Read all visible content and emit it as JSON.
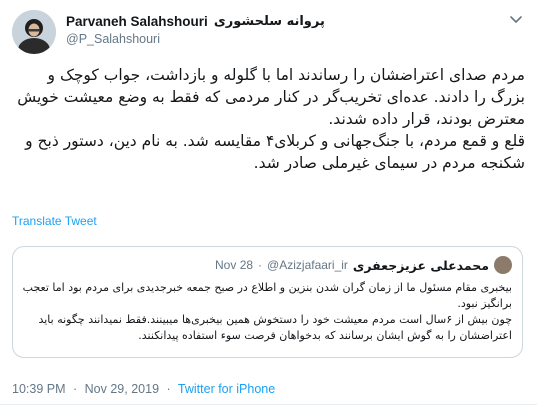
{
  "author": {
    "display_name": "Parvaneh Salahshouri",
    "display_name_fa": "پروانه سلحشوری",
    "handle": "@P_Salahshouri"
  },
  "tweet": {
    "paragraphs": [
      "مردم صدای اعتراضشان را رساندند اما با گلوله و بازداشت، جواب کوچک و بزرگ را دادند. عده‌ای تخریب‌گر در کنار مردمی که فقط به وضع معیشت خویش معترض بودند، قرار داده شدند.",
      "قلع و قمع مردم، با جنگ‌جهانی و کربلای۴ مقایسه شد. به نام دین، دستور ذبح و شکنجه مردم در سیمای غیرملی صادر شد."
    ],
    "translate_label": "Translate Tweet"
  },
  "quoted": {
    "name": "محمدعلی عزیزجعفری",
    "handle": "@Azizjafaari_ir",
    "dot": "·",
    "date": "Nov 28",
    "paragraphs": [
      "بیخبری مقام مسئول ما از زمان گران شدن بنزین و اطلاع در صبح جمعه خبرجدیدی برای مردم بود اما تعجب برانگیز نبود.",
      "چون بیش از ۶سال است مردم معیشت خود را دستخوش همین بیخبری‌ها میبینند.فقط نمیدانند چگونه باید اعتراضشان را به گوش ایشان برسانند که بدخواهان فرصت سوء استفاده پیدانکنند."
    ]
  },
  "meta": {
    "time": "10:39 PM",
    "dot": "·",
    "date": "Nov 29, 2019",
    "source": "Twitter for iPhone"
  },
  "icons": {
    "menu": "chevron-down-icon",
    "avatar": "avatar"
  },
  "colors": {
    "link": "#1da1f2",
    "muted": "#657786",
    "text": "#14171a",
    "border": "#ccd6dd"
  }
}
